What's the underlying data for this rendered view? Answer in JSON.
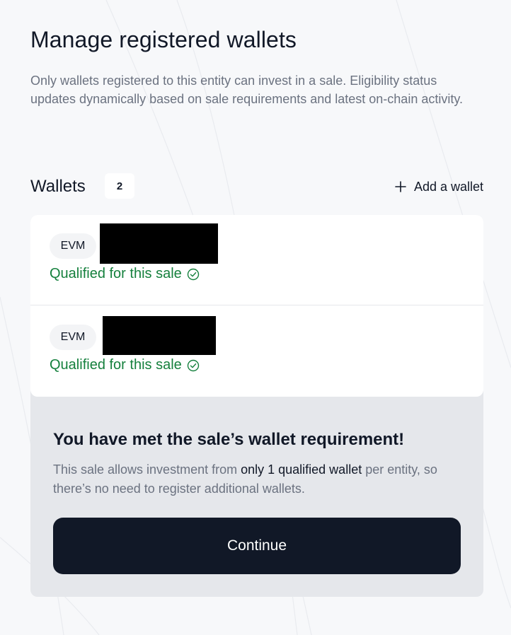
{
  "page": {
    "title": "Manage registered wallets",
    "subtitle": "Only wallets registered to this entity can invest in a sale. Eligibility status updates dynamically based on sale requirements and latest on-chain activity."
  },
  "wallets": {
    "label": "Wallets",
    "count": "2",
    "add_label": "Add a wallet",
    "add_icon": "plus-icon",
    "items": [
      {
        "chain": "EVM",
        "status": "Qualified for this sale",
        "status_icon": "check-circle-icon",
        "status_color": "#15803d"
      },
      {
        "chain": "EVM",
        "status": "Qualified for this sale",
        "status_icon": "check-circle-icon",
        "status_color": "#15803d"
      }
    ]
  },
  "notice": {
    "title": "You have met the sale’s wallet requirement!",
    "body_before": "This sale allows investment from ",
    "body_strong": "only 1 qualified wallet",
    "body_after": " per entity, so there’s no need to register additional wallets."
  },
  "continue_label": "Continue",
  "colors": {
    "background": "#f7f8fa",
    "primary_button": "#111827",
    "success": "#15803d",
    "card_bg": "#e5e7eb"
  }
}
